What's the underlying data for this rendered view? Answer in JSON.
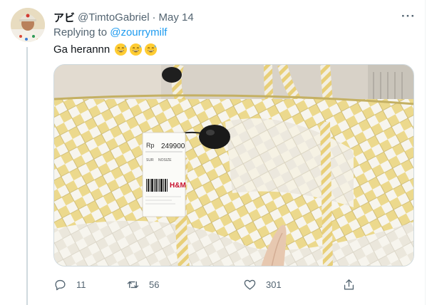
{
  "tweet": {
    "display_name": "アビ",
    "handle": "@TimtoGabriel",
    "separator": "·",
    "date": "May 14",
    "replying_prefix": "Replying to",
    "replying_to": "@zourrymilf",
    "text": "Ga herannn",
    "emojis": [
      "grinning-sweat-emoji",
      "grinning-sweat-emoji",
      "grinning-sweat-emoji"
    ],
    "more_label": "···"
  },
  "media": {
    "price_tag": {
      "currency": "Rp",
      "price": "249900",
      "size_label": "SUR",
      "size_value": "NOSIZE",
      "brand": "H&M"
    }
  },
  "actions": {
    "replies": "11",
    "retweets": "56",
    "likes": "301"
  },
  "colors": {
    "text_primary": "#0f1419",
    "text_secondary": "#536471",
    "link": "#1d9bf0",
    "divider": "#cfd9de",
    "basket_yellow": "#ecd98d",
    "basket_white": "#f7f5ee"
  }
}
